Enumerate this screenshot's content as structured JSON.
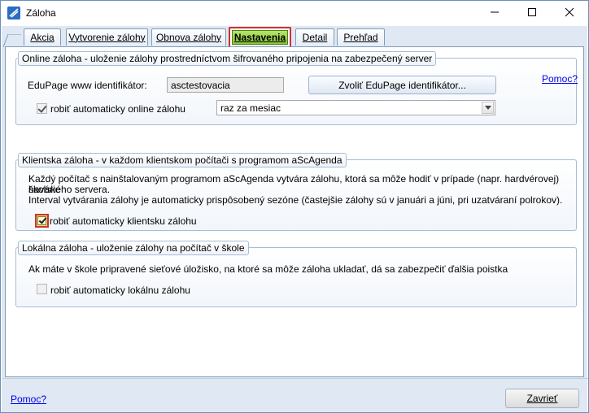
{
  "window": {
    "title": "Záloha",
    "icon": "app-logo-icon",
    "controls": [
      "minimize-icon",
      "maximize-icon",
      "close-icon"
    ]
  },
  "tabs": [
    {
      "label": "Akcia",
      "active": false
    },
    {
      "label": "Vytvorenie zálohy",
      "active": false
    },
    {
      "label": "Obnova zálohy",
      "active": false
    },
    {
      "label": "Nastavenia",
      "active": true
    },
    {
      "label": "Detail",
      "active": false
    },
    {
      "label": "Prehľad",
      "active": false
    }
  ],
  "online": {
    "legend": "Online záloha - uloženie zálohy prostredníctvom šifrovaného pripojenia na zabezpečený server",
    "id_label": "EduPage www identifikátor:",
    "id_value": "asctestovacia",
    "choose_button": "Zvoliť EduPage identifikátor...",
    "help_link": "Pomoc?",
    "auto_label": "robiť automaticky online zálohu",
    "auto_checked": true,
    "frequency_value": "raz za mesiac"
  },
  "client": {
    "legend": "Klientska záloha - v každom klientskom počítači s programom aScAgenda",
    "desc_line1": "Každý počítač s nainštalovaným programom aScAgenda vytvára zálohu, ktorá sa môže hodiť v prípade (napr. hardvérovej) havárie",
    "desc_line2": "školského servera.",
    "desc_line3": "Interval vytvárania zálohy je automaticky prispôsobený sezóne (častejšie zálohy sú v januári a júni, pri uzatváraní polrokov).",
    "auto_label": "robiť automaticky klientsku zálohu",
    "auto_checked": true
  },
  "local": {
    "legend": "Lokálna záloha - uloženie zálohy na počítač v škole",
    "desc": "Ak máte v škole pripravené sieťové úložisko, na ktoré sa môže záloha ukladať, dá sa zabezpečiť ďalšia poistka",
    "auto_label": "robiť automaticky lokálnu zálohu",
    "auto_checked": false
  },
  "footer": {
    "help_link": "Pomoc?",
    "close_button": "Zavrieť"
  },
  "colors": {
    "accent_highlight": "#d0312d",
    "active_tab_fill": "#89c83a",
    "panel_background": "#dfe8f3",
    "link": "#0000ee"
  }
}
